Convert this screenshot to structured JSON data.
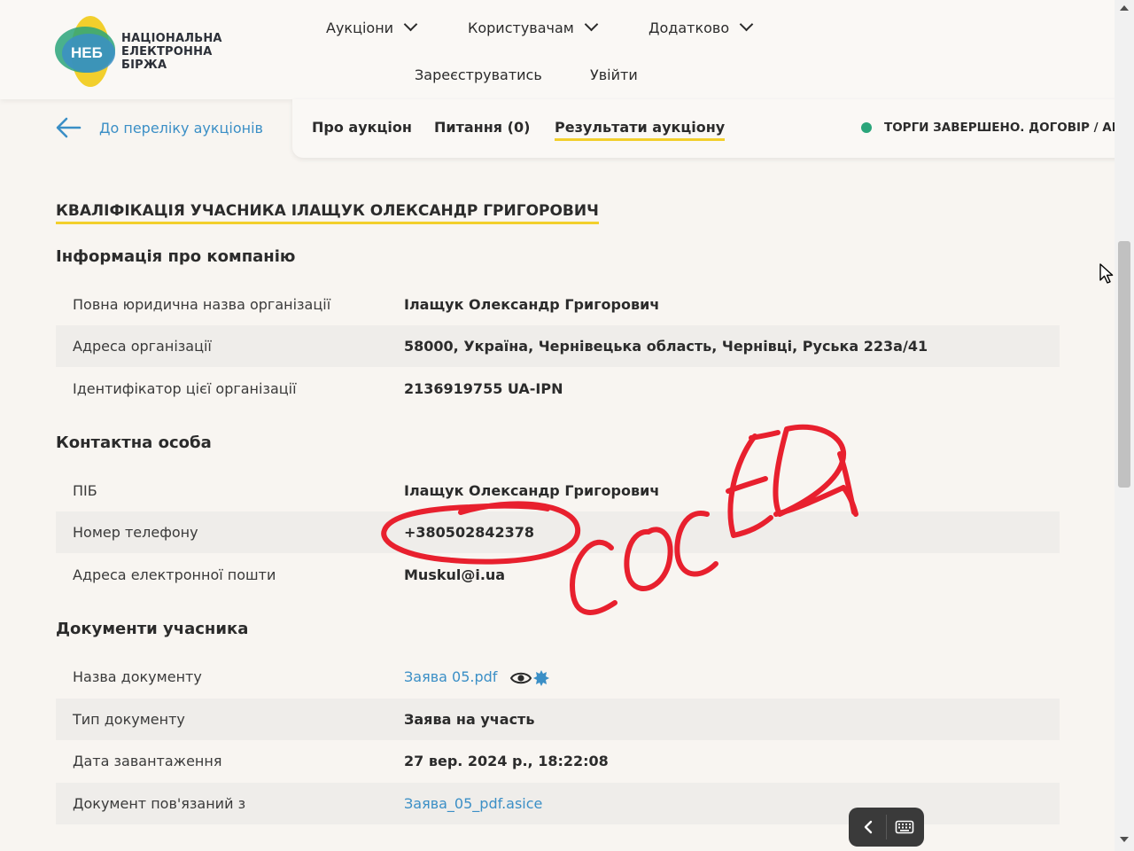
{
  "brand": {
    "logo_abbr": "НЕБ",
    "name_line1": "НАЦІОНАЛЬНА",
    "name_line2": "ЕЛЕКТРОННА",
    "name_line3": "БІРЖА",
    "colors": {
      "blue": "#3b8fc6",
      "yellow": "#f2cf2c",
      "green": "#2aa57a"
    }
  },
  "nav": {
    "items": [
      "Аукціони",
      "Користувачам",
      "Додатково"
    ],
    "register": "Зареєструватись",
    "login": "Увійти"
  },
  "back_link": "До переліку аукціонів",
  "tabs": [
    "Про аукціон",
    "Питання (0)",
    "Результати аукціону"
  ],
  "active_tab": "Результати аукціону",
  "status": "ТОРГИ ЗАВЕРШЕНО. ДОГОВІР / АКТ",
  "qualification_title": "КВАЛІФІКАЦІЯ УЧАСНИКА ІЛАЩУК ОЛЕКСАНДР ГРИГОРОВИЧ",
  "company": {
    "title": "Інформація про компанію",
    "rows": [
      {
        "label": "Повна юридична назва організації",
        "value": "Ілащук Олександр Григорович"
      },
      {
        "label": "Адреса організації",
        "value": "58000, Україна, Чернівецька область, Чернівці, Руська 223а/41"
      },
      {
        "label": "Ідентифікатор цієї організації",
        "value": "2136919755 UA-IPN"
      }
    ]
  },
  "contact": {
    "title": "Контактна особа",
    "rows": [
      {
        "label": "ПІБ",
        "value": "Ілащук Олександр Григорович"
      },
      {
        "label": "Номер телефону",
        "value": "+380502842378"
      },
      {
        "label": "Адреса електронної пошти",
        "value": "Muskul@i.ua"
      }
    ]
  },
  "documents": {
    "title": "Документи учасника",
    "rows": [
      {
        "label": "Назва документу",
        "value": "Заява 05.pdf"
      },
      {
        "label": "Тип документу",
        "value": "Заява на участь"
      },
      {
        "label": "Дата завантаження",
        "value": "27 вер. 2024 р., 18:22:08"
      },
      {
        "label": "Документ пов'язаний з",
        "value": "Заява_05_pdf.asice"
      }
    ]
  },
  "annotation": {
    "handwritten_text": "СОСЕД",
    "ink_color": "#e8202e"
  }
}
